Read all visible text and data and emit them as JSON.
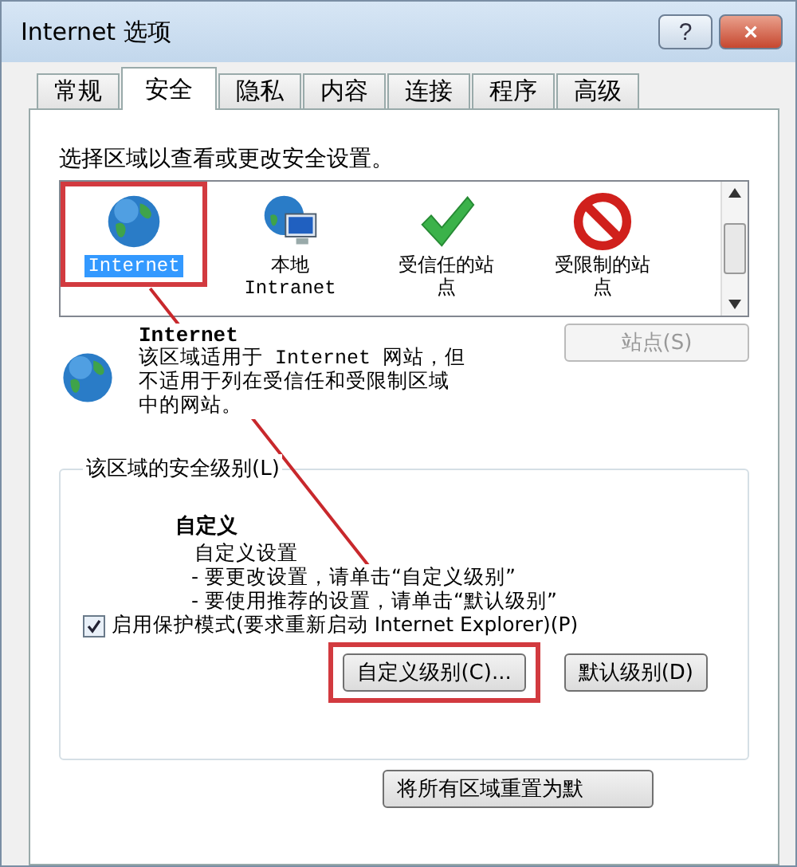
{
  "window": {
    "title": "Internet 选项",
    "buttons": [
      {
        "kind": "help",
        "label": "?"
      },
      {
        "kind": "close",
        "label": "×"
      }
    ]
  },
  "tabs": [
    {
      "label": "常规",
      "selected": false
    },
    {
      "label": "安全",
      "selected": true
    },
    {
      "label": "隐私",
      "selected": false
    },
    {
      "label": "内容",
      "selected": false
    },
    {
      "label": "连接",
      "selected": false
    },
    {
      "label": "程序",
      "selected": false
    },
    {
      "label": "高级",
      "selected": false
    }
  ],
  "zone_prompt": "选择区域以查看或更改安全设置。",
  "zones": [
    {
      "kind": "internet",
      "label": "Internet",
      "selected": true,
      "highlighted": true
    },
    {
      "kind": "intranet",
      "label": "本地\nIntranet",
      "selected": false,
      "highlighted": false
    },
    {
      "kind": "trusted",
      "label": "受信任的站点",
      "selected": false,
      "highlighted": false
    },
    {
      "kind": "restricted",
      "label": "受限制的站点",
      "selected": false,
      "highlighted": false
    }
  ],
  "zone_info": {
    "title": "Internet",
    "description": "该区域适用于 Internet 网站，但不适用于列在受信任和受限制区域中的网站。",
    "sites_button": {
      "label": "站点(S)",
      "disabled": true
    }
  },
  "security_level": {
    "legend": "该区域的安全级别(L)",
    "level_name": "自定义",
    "lines": [
      "自定义设置",
      "- 要更改设置，请单击“自定义级别”",
      "- 要使用推荐的设置，请单击“默认级别”"
    ],
    "protected_mode": {
      "label": "启用保护模式(要求重新启动 Internet Explorer)(P)",
      "checked": true
    },
    "buttons": [
      {
        "label": "自定义级别(C)...",
        "highlighted": true
      },
      {
        "label": "默认级别(D)",
        "highlighted": false
      }
    ]
  },
  "reset_button": {
    "label": "将所有区域重置为默"
  },
  "annotation_arrow": true
}
